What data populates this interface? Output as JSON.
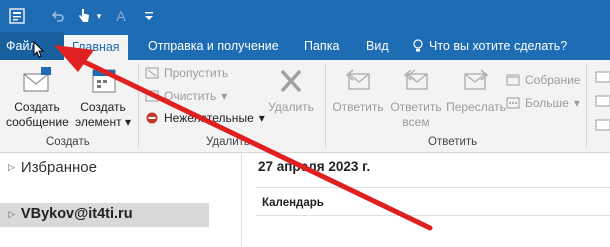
{
  "quick_access": {
    "send_receive_icon": "send-receive-icon",
    "undo_icon": "undo-icon",
    "touch_icon": "touch-mode-icon",
    "dropdown_icon": "chevron-down-icon",
    "font_icon_label": "A",
    "customize_icon": "customize-qat-icon"
  },
  "tabs": {
    "file": "Файл",
    "home": "Главная",
    "send_receive": "Отправка и получение",
    "folder": "Папка",
    "view": "Вид",
    "tell_me": "Что вы хотите сделать?"
  },
  "ribbon": {
    "new_email_line1": "Создать",
    "new_email_line2": "сообщение",
    "new_item_line1": "Создать",
    "new_item_line2": "элемент",
    "group_new": "Создать",
    "ignore": "Пропустить",
    "clean_up": "Очистить",
    "junk": "Нежелательные",
    "delete": "Удалить",
    "group_delete": "Удалить",
    "reply": "Ответить",
    "reply_all_line1": "Ответить",
    "reply_all_line2": "всем",
    "forward": "Переслать",
    "meeting": "Собрание",
    "more": "Больше",
    "group_respond": "Ответить"
  },
  "nav": {
    "favorites": "Избранное",
    "account": "VBykov@it4ti.ru"
  },
  "main": {
    "date": "27 апреля 2023 г.",
    "calendar": "Календарь"
  },
  "colors": {
    "brand": "#1e6cb3",
    "annotation_arrow": "#e02020"
  }
}
